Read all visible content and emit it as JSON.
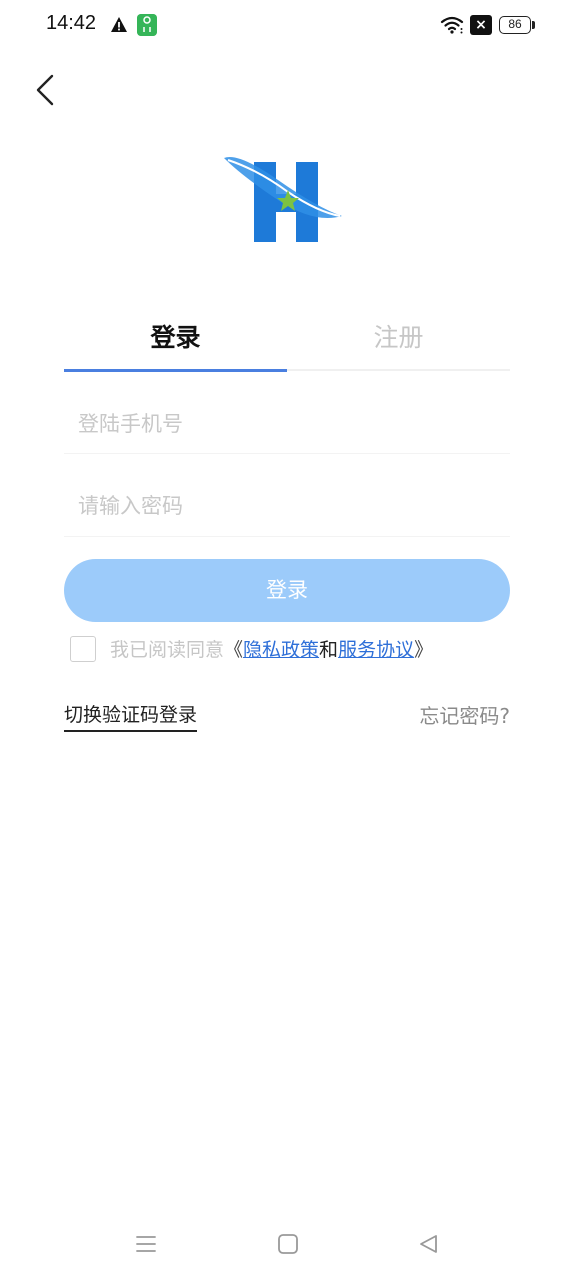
{
  "status_bar": {
    "time": "14:42",
    "battery": "86",
    "sim_glyph": "×"
  },
  "icons": {
    "back": "chevron-left-icon",
    "warning": "warning-icon",
    "notification": "app-notification-icon",
    "wifi": "wifi-icon",
    "logo": "app-logo"
  },
  "tabs": [
    {
      "label": "登录",
      "active": true
    },
    {
      "label": "注册",
      "active": false
    }
  ],
  "form": {
    "phone_placeholder": "登陆手机号",
    "phone_value": "",
    "password_placeholder": "请输入密码",
    "password_value": "",
    "login_button": "登录"
  },
  "agreement": {
    "checked": false,
    "prefix": "我已阅读同意",
    "open_bracket": "《",
    "privacy_link": "隐私政策",
    "and": "和",
    "service_link": "服务协议",
    "close_bracket": "》"
  },
  "links": {
    "switch_login": "切换验证码登录",
    "forgot_password": "忘记密码?"
  },
  "colors": {
    "accent": "#4a7fe0",
    "button_disabled": "#9ccbfa",
    "link": "#2e6fd8",
    "placeholder": "#c8c8c8"
  }
}
